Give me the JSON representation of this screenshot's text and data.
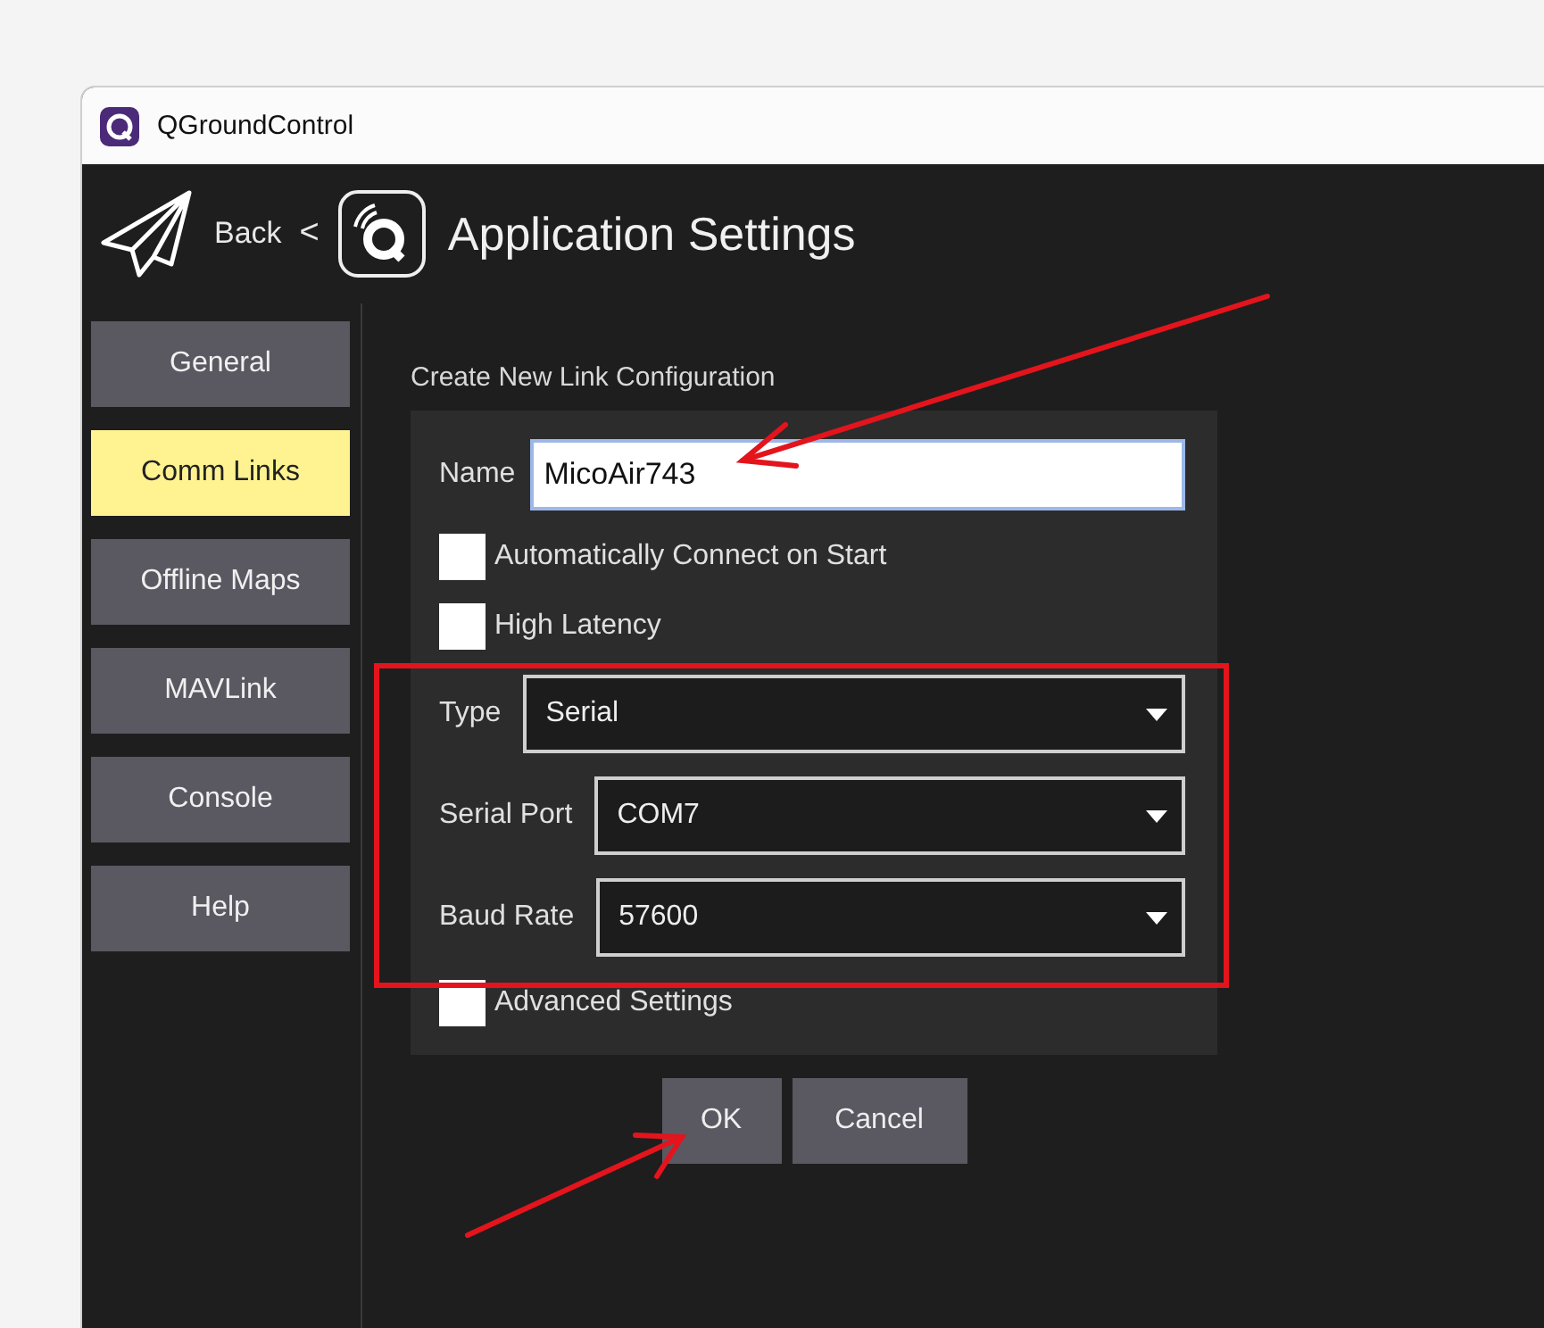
{
  "window": {
    "title": "QGroundControl"
  },
  "header": {
    "back": "Back",
    "separator": "<",
    "title": "Application Settings"
  },
  "sidebar": {
    "items": [
      {
        "label": "General",
        "selected": false
      },
      {
        "label": "Comm Links",
        "selected": true
      },
      {
        "label": "Offline Maps",
        "selected": false
      },
      {
        "label": "MAVLink",
        "selected": false
      },
      {
        "label": "Console",
        "selected": false
      },
      {
        "label": "Help",
        "selected": false
      }
    ]
  },
  "form": {
    "heading": "Create New Link Configuration",
    "name": {
      "label": "Name",
      "value": "MicoAir743"
    },
    "checkboxes": [
      {
        "label": "Automatically Connect on Start",
        "checked": false
      },
      {
        "label": "High Latency",
        "checked": false
      }
    ],
    "dropdowns": [
      {
        "label": "Type",
        "value": "Serial"
      },
      {
        "label": "Serial Port",
        "value": "COM7"
      },
      {
        "label": "Baud Rate",
        "value": "57600"
      }
    ],
    "advanced": {
      "label": "Advanced Settings",
      "checked": false
    }
  },
  "buttons": [
    "OK",
    "Cancel"
  ]
}
